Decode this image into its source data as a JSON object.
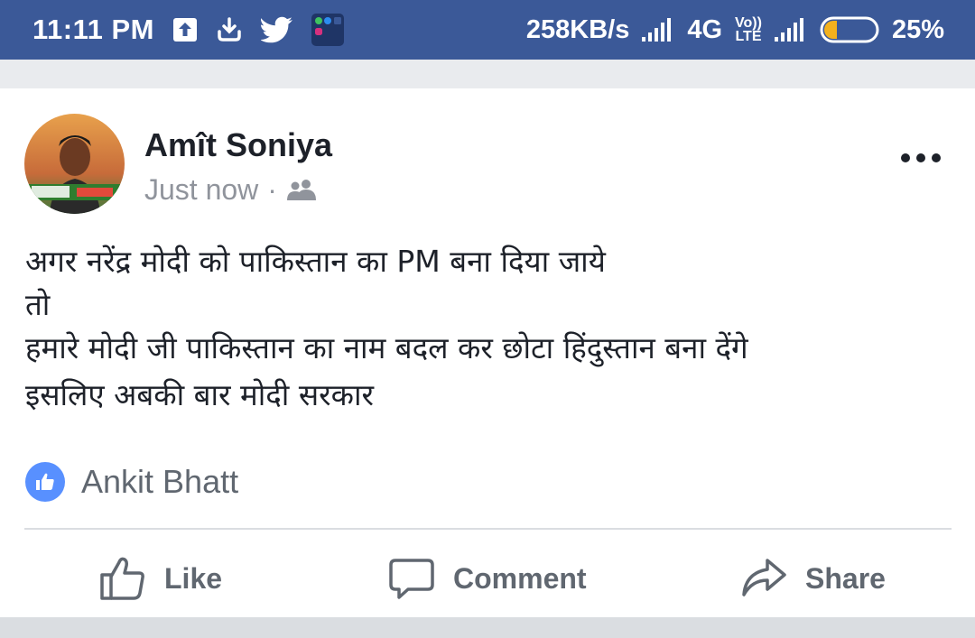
{
  "status_bar": {
    "time": "11:11 PM",
    "network_speed": "258KB/s",
    "network_type": "4G",
    "volte_top": "Vo))",
    "volte_bottom": "LTE",
    "battery_percent": "25%",
    "battery_level": 0.25,
    "icons": [
      "upload-icon",
      "download-icon",
      "twitter-icon",
      "notification-apps-icon",
      "signal-icon",
      "battery-icon"
    ]
  },
  "post": {
    "author": "Amît Soniya",
    "timestamp": "Just now",
    "separator": "·",
    "privacy_icon": "friends-icon",
    "body_lines": [
      "अगर नरेंद्र मोदी को पाकिस्तान का PM बना दिया जाये",
      "तो",
      "हमारे मोदी जी पाकिस्तान का नाम बदल कर छोटा हिंदुस्तान बना देंगे",
      "इसलिए अबकी बार मोदी सरकार"
    ],
    "reaction_icon": "like-reaction-icon",
    "reactor": "Ankit Bhatt"
  },
  "actions": {
    "like_label": "Like",
    "comment_label": "Comment",
    "share_label": "Share"
  },
  "colors": {
    "status_bar": "#3b5998",
    "like_blue": "#5890ff",
    "text_primary": "#1d2129",
    "text_secondary": "#606770"
  }
}
